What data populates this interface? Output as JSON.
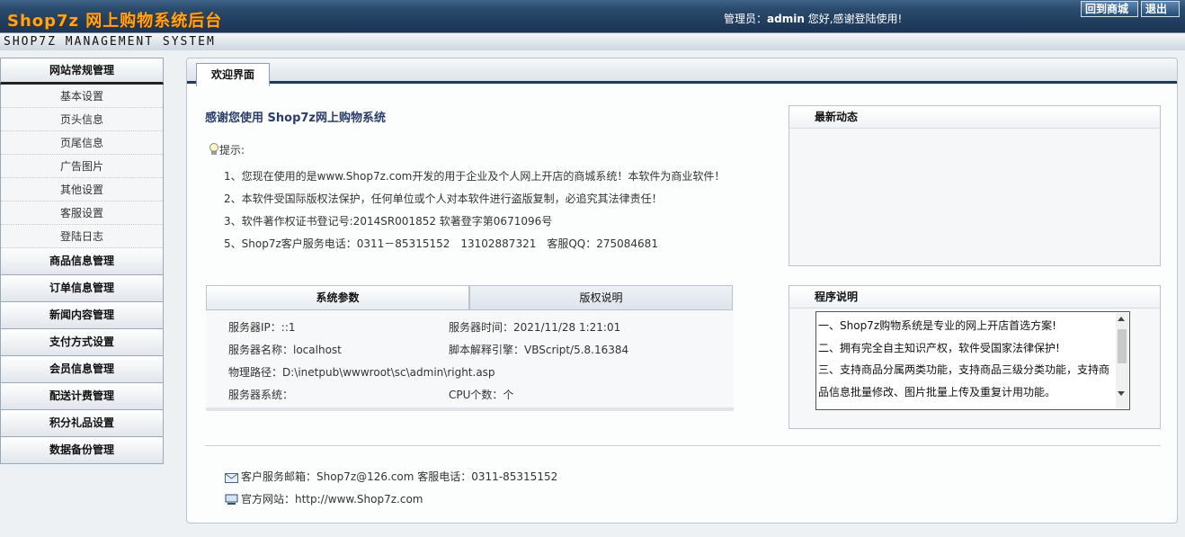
{
  "header": {
    "logo_text": "Shop7z 网上购物系统后台",
    "subtitle": "SHOP7Z MANAGEMENT SYSTEM",
    "admin_prefix": "管理员：",
    "admin_name": "admin",
    "admin_suffix": " 您好,感谢登陆使用!",
    "home_button": "回到商城",
    "logout_button": "退出"
  },
  "sidebar": {
    "active_group": "网站常规管理",
    "sub_items": [
      "基本设置",
      "页头信息",
      "页尾信息",
      "广告图片",
      "其他设置",
      "客服设置",
      "登陆日志"
    ],
    "groups": [
      "商品信息管理",
      "订单信息管理",
      "新闻内容管理",
      "支付方式设置",
      "会员信息管理",
      "配送计费管理",
      "积分礼品设置",
      "数据备份管理"
    ]
  },
  "main": {
    "tab_label": "欢迎界面",
    "welcome_title": "感谢您使用 Shop7z网上购物系统",
    "tips_label": "提示:",
    "tips": [
      "1、您现在使用的是www.Shop7z.com开发的用于企业及个人网上开店的商城系统！本软件为商业软件！",
      "2、本软件受国际版权法保护，任何单位或个人对本软件进行盗版复制，必追究其法律责任！",
      "3、软件著作权证书登记号:2014SR001852 软著登字第0671096号",
      "5、Shop7z客户服务电话：0311－85315152　13102887321　客服QQ：275084681"
    ],
    "params_tab_active": "系统参数",
    "params_tab_other": "版权说明",
    "params": {
      "server_ip": "服务器IP：::1",
      "server_time": "服务器时间：2021/11/28 1:21:01",
      "server_name": "服务器名称：localhost",
      "script_engine": "脚本解释引擎：VBScript/5.8.16384",
      "physical_path": "物理路径：D:\\inetpub\\wwwroot\\sc\\admin\\right.asp",
      "server_os": "服务器系统：",
      "cpu_count": "CPU个数：个"
    },
    "news_title": "最新动态",
    "notes_title": "程序说明",
    "notes_lines": [
      "一、Shop7z购物系统是专业的网上开店首选方案!",
      "二、拥有完全自主知识产权，软件受国家法律保护!",
      "三、支持商品分属两类功能，支持商品三级分类功能，支持商",
      "品信息批量修改、图片批量上传及重复计用功能。"
    ],
    "footer_email": "客户服务邮箱：Shop7z@126.com 客服电话：0311-85315152",
    "footer_site": "官方网站：http://www.Shop7z.com"
  }
}
